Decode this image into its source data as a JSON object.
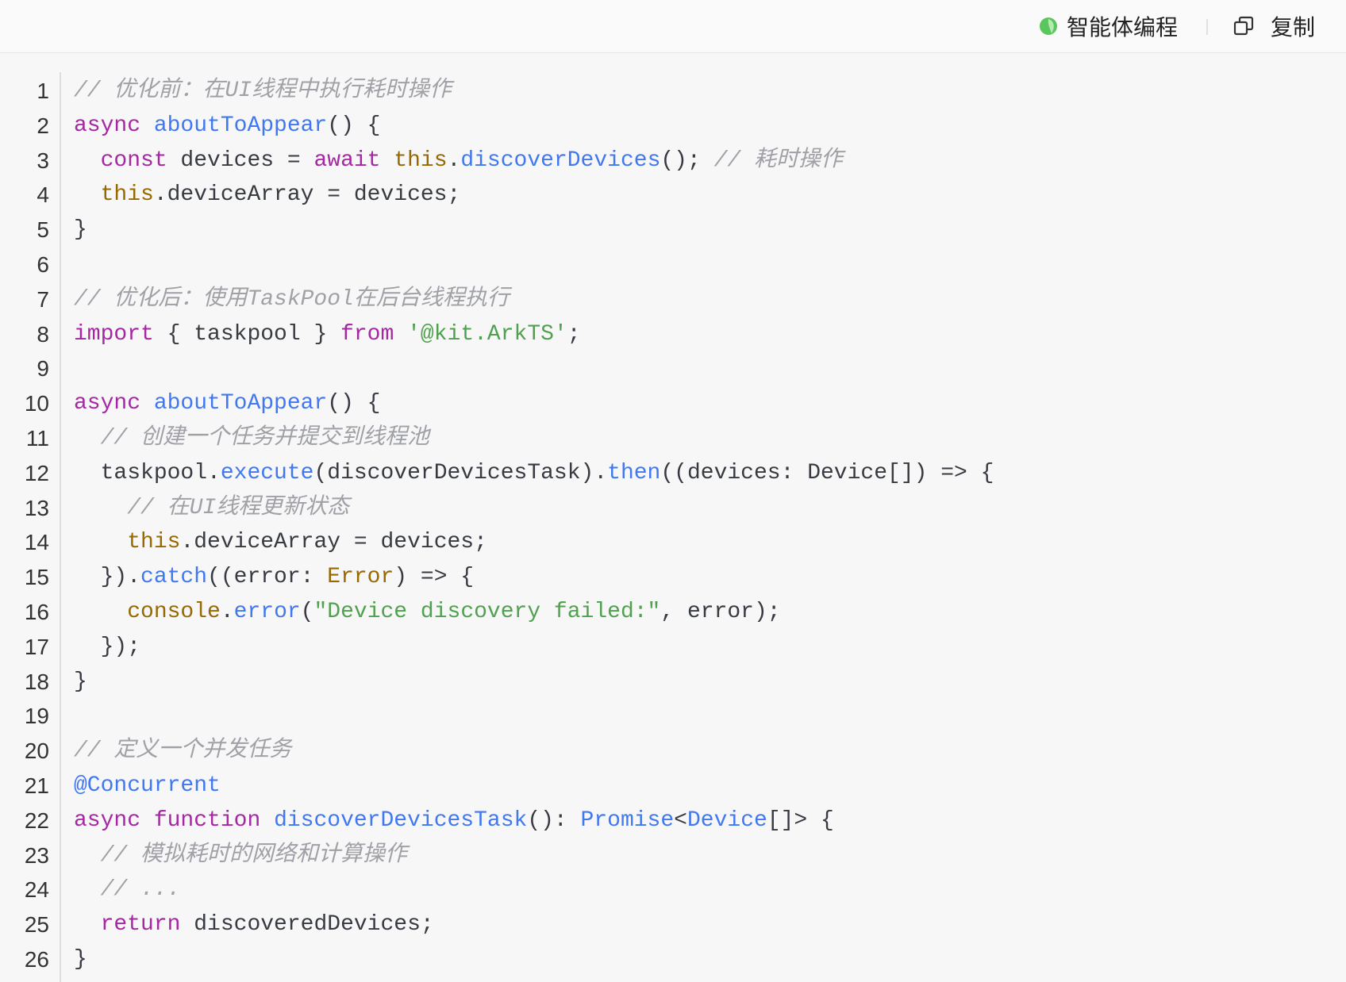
{
  "header": {
    "agent_label": "智能体编程",
    "agent_icon": "agent-logo-icon",
    "copy_label": "复制",
    "copy_icon": "copy-icon"
  },
  "theme": {
    "kw": "#a626a4",
    "fn": "#4078f2",
    "builtin": "#986801",
    "str": "#50a14f",
    "cmt": "#a0a1a7",
    "plain": "#383a42",
    "line_number": "#333333",
    "agent_icon_color": "#5bc55e"
  },
  "code": {
    "lines": [
      {
        "n": "1",
        "tokens": [
          {
            "t": "cmt",
            "v": "// 优化前：在UI线程中执行耗时操作"
          }
        ]
      },
      {
        "n": "2",
        "tokens": [
          {
            "t": "kw",
            "v": "async"
          },
          {
            "t": "plain",
            "v": " "
          },
          {
            "t": "fn",
            "v": "aboutToAppear"
          },
          {
            "t": "plain",
            "v": "() {"
          }
        ]
      },
      {
        "n": "3",
        "tokens": [
          {
            "t": "plain",
            "v": "  "
          },
          {
            "t": "kw",
            "v": "const"
          },
          {
            "t": "plain",
            "v": " devices = "
          },
          {
            "t": "kw",
            "v": "await"
          },
          {
            "t": "plain",
            "v": " "
          },
          {
            "t": "builtin",
            "v": "this"
          },
          {
            "t": "plain",
            "v": "."
          },
          {
            "t": "fn",
            "v": "discoverDevices"
          },
          {
            "t": "plain",
            "v": "(); "
          },
          {
            "t": "cmt",
            "v": "// 耗时操作"
          }
        ]
      },
      {
        "n": "4",
        "tokens": [
          {
            "t": "plain",
            "v": "  "
          },
          {
            "t": "builtin",
            "v": "this"
          },
          {
            "t": "plain",
            "v": ".deviceArray = devices;"
          }
        ]
      },
      {
        "n": "5",
        "tokens": [
          {
            "t": "plain",
            "v": "}"
          }
        ]
      },
      {
        "n": "6",
        "tokens": []
      },
      {
        "n": "7",
        "tokens": [
          {
            "t": "cmt",
            "v": "// 优化后：使用TaskPool在后台线程执行"
          }
        ]
      },
      {
        "n": "8",
        "tokens": [
          {
            "t": "kw",
            "v": "import"
          },
          {
            "t": "plain",
            "v": " { taskpool } "
          },
          {
            "t": "kw",
            "v": "from"
          },
          {
            "t": "plain",
            "v": " "
          },
          {
            "t": "str",
            "v": "'@kit.ArkTS'"
          },
          {
            "t": "plain",
            "v": ";"
          }
        ]
      },
      {
        "n": "9",
        "tokens": []
      },
      {
        "n": "10",
        "tokens": [
          {
            "t": "kw",
            "v": "async"
          },
          {
            "t": "plain",
            "v": " "
          },
          {
            "t": "fn",
            "v": "aboutToAppear"
          },
          {
            "t": "plain",
            "v": "() {"
          }
        ]
      },
      {
        "n": "11",
        "tokens": [
          {
            "t": "plain",
            "v": "  "
          },
          {
            "t": "cmt",
            "v": "// 创建一个任务并提交到线程池"
          }
        ]
      },
      {
        "n": "12",
        "tokens": [
          {
            "t": "plain",
            "v": "  taskpool."
          },
          {
            "t": "fn",
            "v": "execute"
          },
          {
            "t": "plain",
            "v": "(discoverDevicesTask)."
          },
          {
            "t": "fn",
            "v": "then"
          },
          {
            "t": "plain",
            "v": "((devices: Device[]) => {"
          }
        ]
      },
      {
        "n": "13",
        "tokens": [
          {
            "t": "plain",
            "v": "    "
          },
          {
            "t": "cmt",
            "v": "// 在UI线程更新状态"
          }
        ]
      },
      {
        "n": "14",
        "tokens": [
          {
            "t": "plain",
            "v": "    "
          },
          {
            "t": "builtin",
            "v": "this"
          },
          {
            "t": "plain",
            "v": ".deviceArray = devices;"
          }
        ]
      },
      {
        "n": "15",
        "tokens": [
          {
            "t": "plain",
            "v": "  })."
          },
          {
            "t": "fn",
            "v": "catch"
          },
          {
            "t": "plain",
            "v": "((error: "
          },
          {
            "t": "builtin",
            "v": "Error"
          },
          {
            "t": "plain",
            "v": ") => {"
          }
        ]
      },
      {
        "n": "16",
        "tokens": [
          {
            "t": "plain",
            "v": "    "
          },
          {
            "t": "builtin",
            "v": "console"
          },
          {
            "t": "plain",
            "v": "."
          },
          {
            "t": "fn",
            "v": "error"
          },
          {
            "t": "plain",
            "v": "("
          },
          {
            "t": "str",
            "v": "\"Device discovery failed:\""
          },
          {
            "t": "plain",
            "v": ", error);"
          }
        ]
      },
      {
        "n": "17",
        "tokens": [
          {
            "t": "plain",
            "v": "  });"
          }
        ]
      },
      {
        "n": "18",
        "tokens": [
          {
            "t": "plain",
            "v": "}"
          }
        ]
      },
      {
        "n": "19",
        "tokens": []
      },
      {
        "n": "20",
        "tokens": [
          {
            "t": "cmt",
            "v": "// 定义一个并发任务"
          }
        ]
      },
      {
        "n": "21",
        "tokens": [
          {
            "t": "fn",
            "v": "@Concurrent"
          }
        ]
      },
      {
        "n": "22",
        "tokens": [
          {
            "t": "kw",
            "v": "async"
          },
          {
            "t": "plain",
            "v": " "
          },
          {
            "t": "kw",
            "v": "function"
          },
          {
            "t": "plain",
            "v": " "
          },
          {
            "t": "fn",
            "v": "discoverDevicesTask"
          },
          {
            "t": "plain",
            "v": "(): "
          },
          {
            "t": "fn",
            "v": "Promise"
          },
          {
            "t": "plain",
            "v": "<"
          },
          {
            "t": "fn",
            "v": "Device"
          },
          {
            "t": "plain",
            "v": "[]> {"
          }
        ]
      },
      {
        "n": "23",
        "tokens": [
          {
            "t": "plain",
            "v": "  "
          },
          {
            "t": "cmt",
            "v": "// 模拟耗时的网络和计算操作"
          }
        ]
      },
      {
        "n": "24",
        "tokens": [
          {
            "t": "plain",
            "v": "  "
          },
          {
            "t": "cmt",
            "v": "// ..."
          }
        ]
      },
      {
        "n": "25",
        "tokens": [
          {
            "t": "plain",
            "v": "  "
          },
          {
            "t": "kw",
            "v": "return"
          },
          {
            "t": "plain",
            "v": " discoveredDevices;"
          }
        ]
      },
      {
        "n": "26",
        "tokens": [
          {
            "t": "plain",
            "v": "}"
          }
        ]
      }
    ]
  }
}
